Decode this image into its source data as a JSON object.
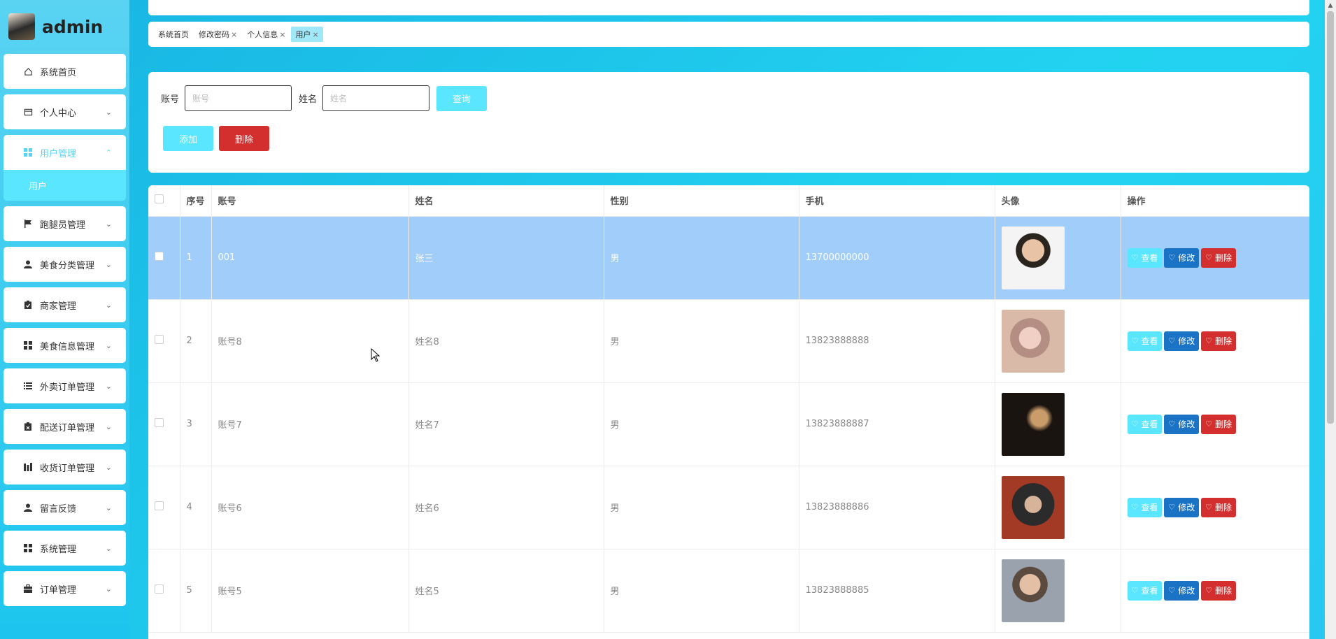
{
  "sidebar": {
    "brand": "admin",
    "items": [
      {
        "label": "系统首页",
        "icon": "home-icon"
      },
      {
        "label": "个人中心",
        "icon": "wallet-icon"
      },
      {
        "label": "用户管理",
        "icon": "grid-icon"
      },
      {
        "label": "跑腿员管理",
        "icon": "flag-icon"
      },
      {
        "label": "美食分类管理",
        "icon": "person-icon"
      },
      {
        "label": "商家管理",
        "icon": "clipboard-icon"
      },
      {
        "label": "美食信息管理",
        "icon": "grid-icon"
      },
      {
        "label": "外卖订单管理",
        "icon": "list-icon"
      },
      {
        "label": "配送订单管理",
        "icon": "clipboard-icon"
      },
      {
        "label": "收货订单管理",
        "icon": "chart-icon"
      },
      {
        "label": "留言反馈",
        "icon": "person-icon"
      },
      {
        "label": "系统管理",
        "icon": "grid-icon"
      },
      {
        "label": "订单管理",
        "icon": "briefcase-icon"
      }
    ],
    "submenu_label": "用户"
  },
  "tabs": [
    {
      "label": "系统首页"
    },
    {
      "label": "修改密码"
    },
    {
      "label": "个人信息"
    },
    {
      "label": "用户"
    }
  ],
  "search": {
    "account_label": "账号",
    "account_placeholder": "账号",
    "name_label": "姓名",
    "name_placeholder": "姓名",
    "query_button": "查询",
    "add_button": "添加",
    "delete_button": "删除"
  },
  "table": {
    "headers": [
      "序号",
      "账号",
      "姓名",
      "性别",
      "手机",
      "头像",
      "操作"
    ],
    "rows": [
      {
        "index": "1",
        "account": "001",
        "name": "张三",
        "gender": "男",
        "phone": "13700000000"
      },
      {
        "index": "2",
        "account": "账号8",
        "name": "姓名8",
        "gender": "男",
        "phone": "13823888888"
      },
      {
        "index": "3",
        "account": "账号7",
        "name": "姓名7",
        "gender": "男",
        "phone": "13823888887"
      },
      {
        "index": "4",
        "account": "账号6",
        "name": "姓名6",
        "gender": "男",
        "phone": "13823888886"
      },
      {
        "index": "5",
        "account": "账号5",
        "name": "姓名5",
        "gender": "男",
        "phone": "13823888885"
      }
    ],
    "ops": {
      "view": "查看",
      "edit": "修改",
      "delete": "删除"
    }
  },
  "colors": {
    "accent": "#5ae6ff",
    "danger": "#d32f2f",
    "edit": "#1a73c5",
    "selected_row": "#a0cdfa"
  }
}
